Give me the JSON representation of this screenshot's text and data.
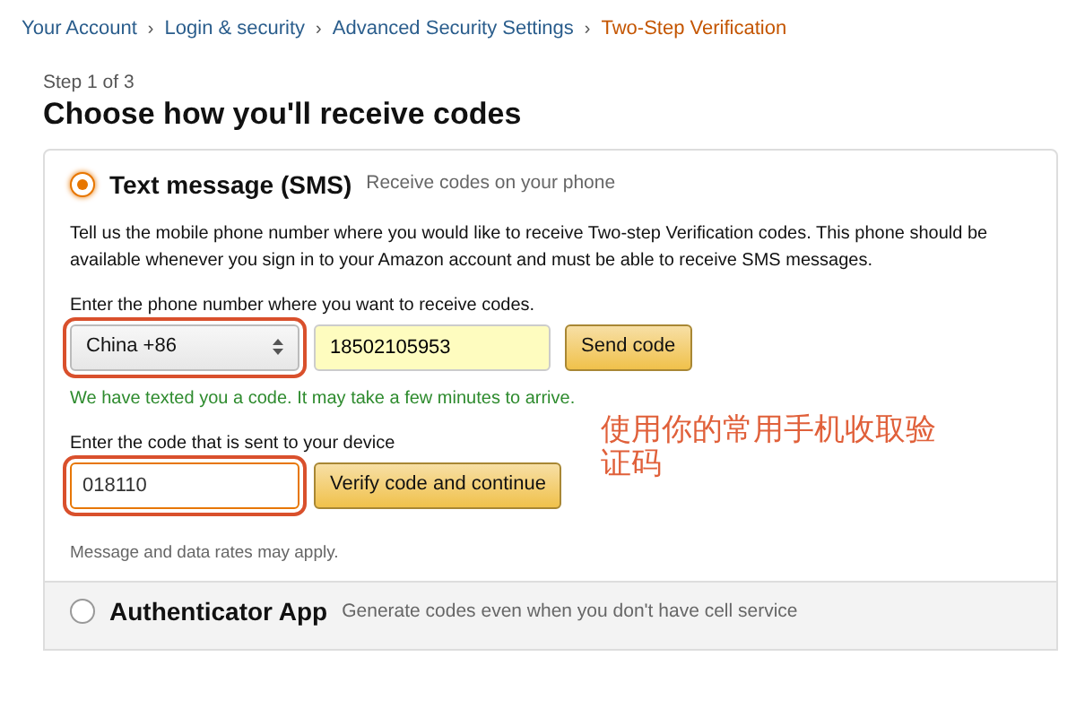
{
  "breadcrumb": [
    {
      "label": "Your Account",
      "current": false
    },
    {
      "label": "Login & security",
      "current": false
    },
    {
      "label": "Advanced Security Settings",
      "current": false
    },
    {
      "label": "Two-Step Verification",
      "current": true
    }
  ],
  "separators": [
    "›",
    "›",
    "›"
  ],
  "step": "Step 1 of 3",
  "heading": "Choose how you'll receive codes",
  "options": [
    {
      "title": "Text message (SMS)",
      "hint": "Receive codes on your phone",
      "selected": true,
      "description": "Tell us the mobile phone number where you would like to receive Two-step Verification codes. This phone should be available whenever you sign in to your Amazon account and must be able to receive SMS messages.",
      "phone_label": "Enter the phone number where you want to receive codes.",
      "country": {
        "value": "China +86",
        "highlighted": true
      },
      "phone": {
        "value": "18502105953"
      },
      "send_button": "Send code",
      "success": "We have texted you a code. It may take a few minutes to arrive.",
      "code_label": "Enter the code that is sent to your device",
      "code": {
        "value": "018110",
        "highlighted": true
      },
      "verify_button": "Verify code and continue",
      "note": "Message and data rates may apply."
    },
    {
      "title": "Authenticator App",
      "hint": "Generate codes even when you don't have cell service",
      "selected": false
    }
  ],
  "annotation": "使用你的常用手机收取验证码"
}
